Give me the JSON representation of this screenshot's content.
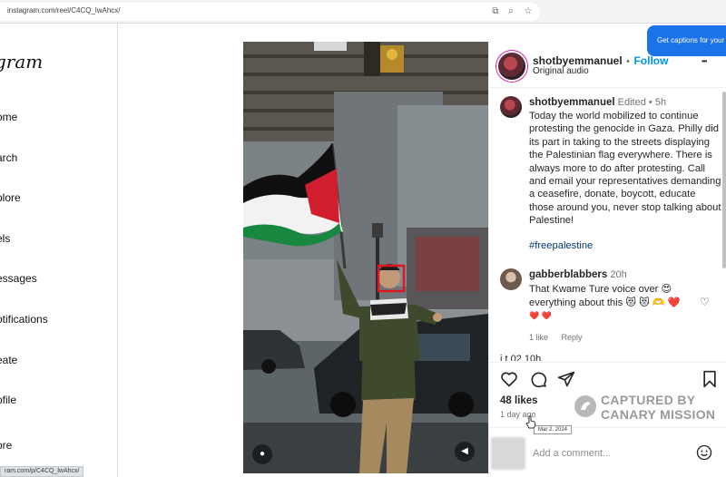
{
  "browser": {
    "url": "instagram.com/reel/C4CQ_lwAhcx/",
    "status_url": "ram.com/p/C4CQ_lwAhcx/",
    "caption_button": "Get captions for your a"
  },
  "sidebar": {
    "logo": "gram",
    "items": [
      {
        "label": "ome"
      },
      {
        "label": "arch"
      },
      {
        "label": "plore"
      },
      {
        "label": "els"
      },
      {
        "label": "essages"
      },
      {
        "label": "otifications"
      },
      {
        "label": "eate"
      },
      {
        "label": "ofile"
      },
      {
        "label": "ore"
      }
    ]
  },
  "post": {
    "header": {
      "username": "shotbyemmanuel",
      "separator": "•",
      "follow": "Follow",
      "audio": "Original audio",
      "more": "•••"
    },
    "caption": {
      "username": "shotbyemmanuel",
      "edited": "Edited",
      "dot": "•",
      "time": "5h",
      "text": "Today the world mobilized to continue protesting the genocide in Gaza. Philly did its part in taking to the streets displaying the Palestinian flag everywhere. There is always more to do after protesting. Call and email your representatives demanding a ceasefire, donate, boycott, educate those around you, never stop talking about Palestine!",
      "hashtag": "#freepalestine"
    },
    "comment": {
      "username": "gabberblabbers",
      "time": "20h",
      "line1": "That Kwame Ture voice over 😍",
      "line2": "everything about this 😻 😻 🫶 ❤️",
      "line3": "❤️ ❤️",
      "likes": "1 like",
      "reply": "Reply"
    },
    "partial_comment": "j    t   02  10h",
    "likes": "48 likes",
    "age": "1 day ago",
    "date_tooltip": "Mar 2, 2024",
    "add_comment_placeholder": "Add a comment..."
  },
  "watermark": {
    "line1": "CAPTURED BY",
    "line2": "CANARY MISSION"
  },
  "colors": {
    "follow_blue": "#0095f6",
    "highlight_box": "#e0141e",
    "flag_red": "#d01e2e",
    "flag_green": "#18873f"
  }
}
